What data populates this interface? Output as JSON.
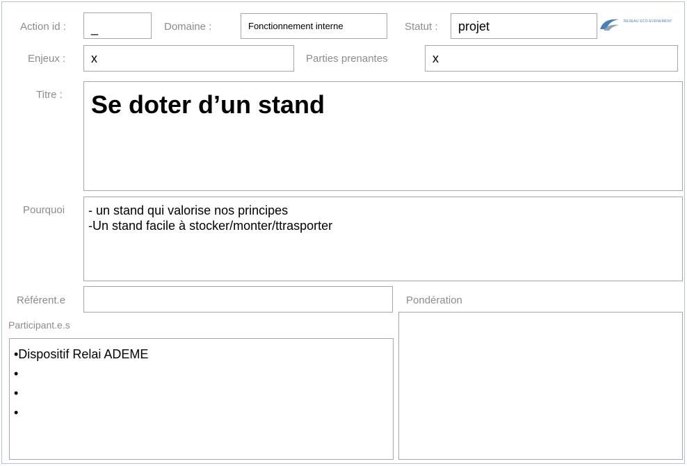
{
  "header": {
    "action_id": {
      "label": "Action id :",
      "value": "_"
    },
    "domaine": {
      "label": "Domaine :",
      "value": "Fonctionnement interne"
    },
    "statut": {
      "label": "Statut :",
      "value": "projet"
    },
    "logo_text": "RESEAU ECO-EVENEMENT"
  },
  "row2": {
    "enjeux": {
      "label": "Enjeux :",
      "value": "x"
    },
    "parties_prenantes": {
      "label": "Parties prenantes",
      "value": "x"
    }
  },
  "titre": {
    "label": "Titre :",
    "value": "Se doter d’un stand"
  },
  "pourquoi": {
    "label": "Pourquoi",
    "lines": [
      "- un stand qui valorise nos principes",
      "-Un stand facile à stocker/monter/ttrasporter"
    ]
  },
  "referent": {
    "label": "Référent.e",
    "value": ""
  },
  "ponderation": {
    "label": "Pondération",
    "value": ""
  },
  "participants": {
    "label": "Participant.e.s",
    "items": [
      "•Dispositif Relai ADEME",
      "•",
      "•",
      "•"
    ]
  }
}
